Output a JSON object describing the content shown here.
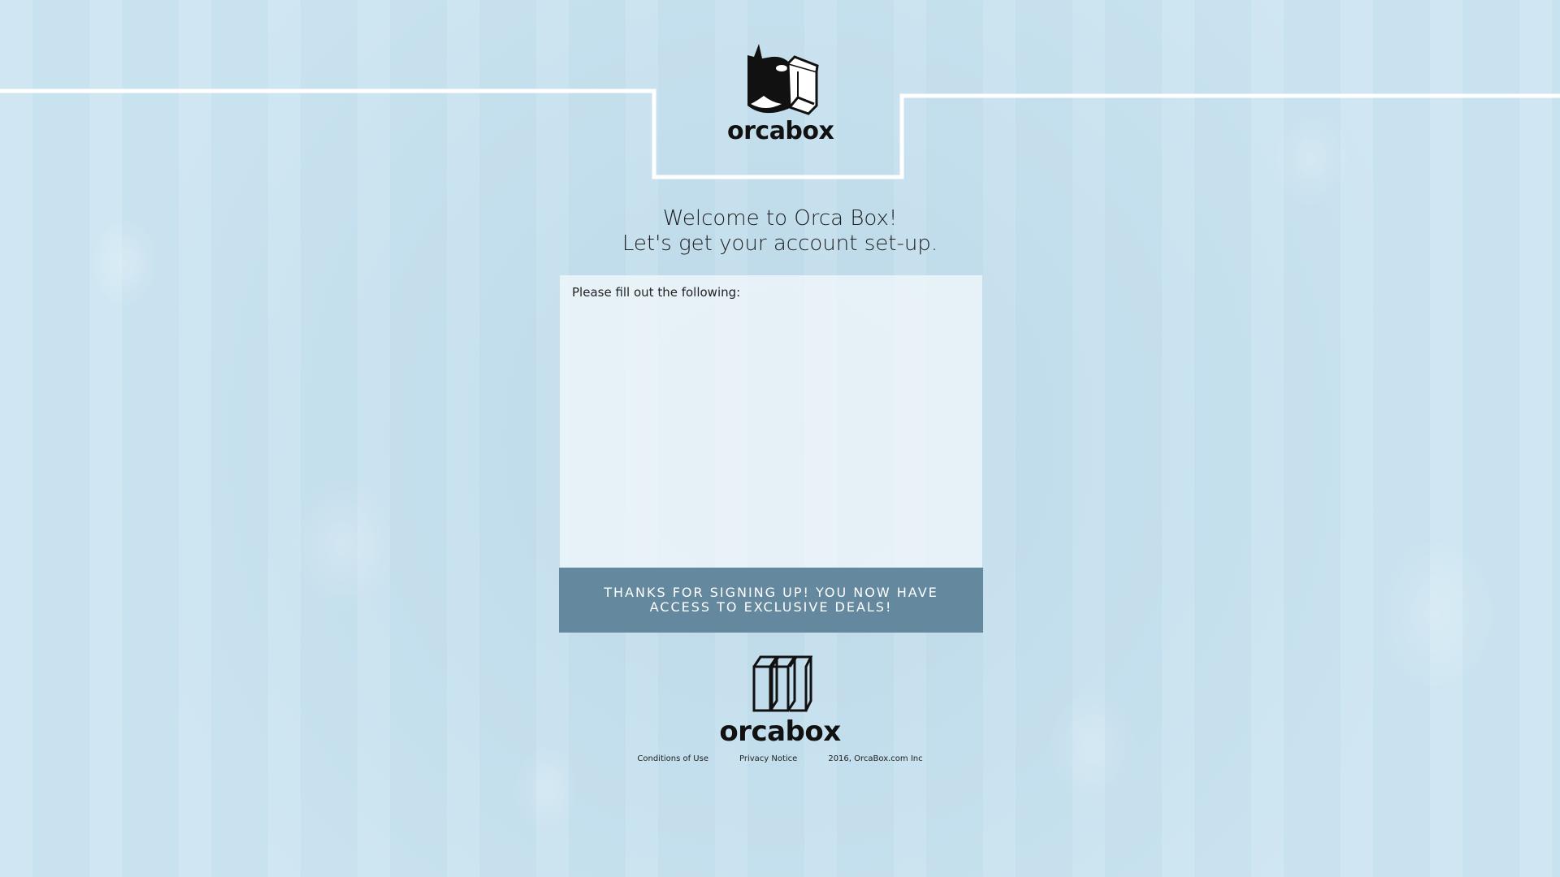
{
  "header": {
    "brand": "orcabox",
    "logo_icon": "orca-box-icon"
  },
  "welcome": {
    "line1": "Welcome to Orca Box!",
    "line2": "Let's get your account set-up."
  },
  "form": {
    "instructions": "Please fill out the following:"
  },
  "confirmation": {
    "message": "THANKS FOR SIGNING UP!  YOU NOW HAVE ACCESS TO EXCLUSIVE DEALS!"
  },
  "footer": {
    "brand": "orcabox",
    "logo_icon": "books-icon",
    "links": {
      "conditions": "Conditions of Use",
      "privacy": "Privacy Notice"
    },
    "copyright": "2016, OrcaBox.com Inc"
  },
  "colors": {
    "background": "#cde6f2",
    "confirmation_bar": "#64889e",
    "frame_line": "#ffffff"
  }
}
